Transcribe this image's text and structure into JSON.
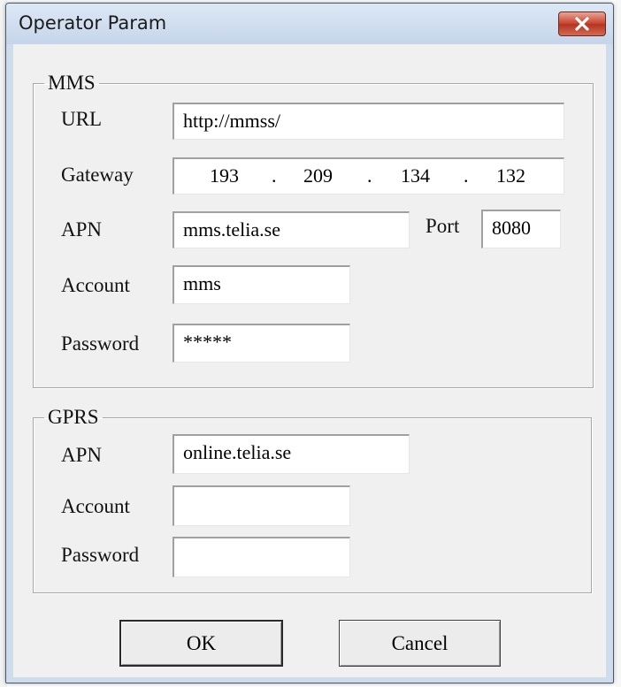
{
  "window": {
    "title": "Operator Param"
  },
  "mms": {
    "legend": "MMS",
    "url_label": "URL",
    "url_value": "http://mmss/",
    "gateway_label": "Gateway",
    "gateway_octets": [
      "193",
      "209",
      "134",
      "132"
    ],
    "gateway_separator": ".",
    "apn_label": "APN",
    "apn_value": "mms.telia.se",
    "port_label": "Port",
    "port_value": "8080",
    "account_label": "Account",
    "account_value": "mms",
    "password_label": "Password",
    "password_value": "*****"
  },
  "gprs": {
    "legend": "GPRS",
    "apn_label": "APN",
    "apn_value": "online.telia.se",
    "account_label": "Account",
    "account_value": "",
    "password_label": "Password",
    "password_value": ""
  },
  "buttons": {
    "ok_label": "OK",
    "cancel_label": "Cancel"
  },
  "icons": {
    "close": "close-icon"
  },
  "colors": {
    "close_button": "#c8452f",
    "dialog_face": "#f0f0f0",
    "title_bar": "#cfdcec"
  }
}
